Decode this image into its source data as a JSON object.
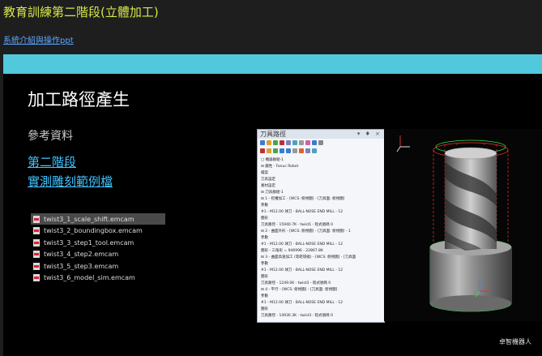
{
  "page": {
    "title": "教育訓練第二階段(立體加工)",
    "link_label": "系統介紹與操作ppt"
  },
  "slide": {
    "title": "加工路徑產生",
    "ref_title": "參考資料",
    "links": [
      "第二階段",
      "實測雕刻範例檔"
    ],
    "files": [
      {
        "name": "twist3_1_scale_shift.emcam",
        "selected": true
      },
      {
        "name": "twist3_2_boundingbox.emcam",
        "selected": false
      },
      {
        "name": "twist3_3_step1_tool.emcam",
        "selected": false
      },
      {
        "name": "twist3_4_step2.emcam",
        "selected": false
      },
      {
        "name": "twist3_5_step3.emcam",
        "selected": false
      },
      {
        "name": "twist3_6_model_sim.emcam",
        "selected": false
      }
    ],
    "credit": "卓智機器人"
  },
  "panel": {
    "title": "刀具路徑",
    "controls": "▾ ♦ ×",
    "tree": [
      "□ 機器群組-1",
      "  ⊟ 屬性 - Fanuc Robot",
      "     檔案",
      "     刀具設定",
      "     素材設定",
      "  ⊟ 刀具群組-1",
      "    ⊟ 1 - 挖槽加工 - [WCS: 俯視圖] - [刀具面: 俯視圖]",
      "         參數",
      "         #1 - M12.00 球刀 - BALL-NOSE END MILL - 12",
      "         圖形",
      "         刀具路徑 - 15940.7K - twist1 - 程式號碼 0",
      "    ⊟ 2 - 曲面外形 - [WCS: 俯視圖] - [刀具面: 俯視圖] - 1",
      "         參數",
      "         #1 - M12.00 球刀 - BALL-NOSE END MILL - 12",
      "         圖形 - 三角形 = 946996 - 22867.8K",
      "    ⊟ 3 - 曲面高速加工 (等距環繞) - [WCS: 俯視圖] - [刀具面",
      "         參數",
      "         #1 - M12.00 球刀 - BALL-NOSE END MILL - 12",
      "         圖形",
      "         刀具路徑 - 1249.0K - twist3 - 程式號碼 0",
      "    ⊟ 4 - 平行 - [WCS: 俯視圖] - [刀具面: 俯視圖]",
      "         參數",
      "         #1 - M12.00 球刀 - BALL-NOSE END MILL - 12",
      "         圖形",
      "         刀具路徑 - 14930.3K - twist3 - 程式號碼 0"
    ]
  },
  "colors": {
    "title": "#d6e64a",
    "link": "#5aa7ff",
    "band": "#52c8dc",
    "slide_link": "#3ec3ff",
    "toolpath": "#ff3030",
    "boundary": "#35e04a"
  }
}
